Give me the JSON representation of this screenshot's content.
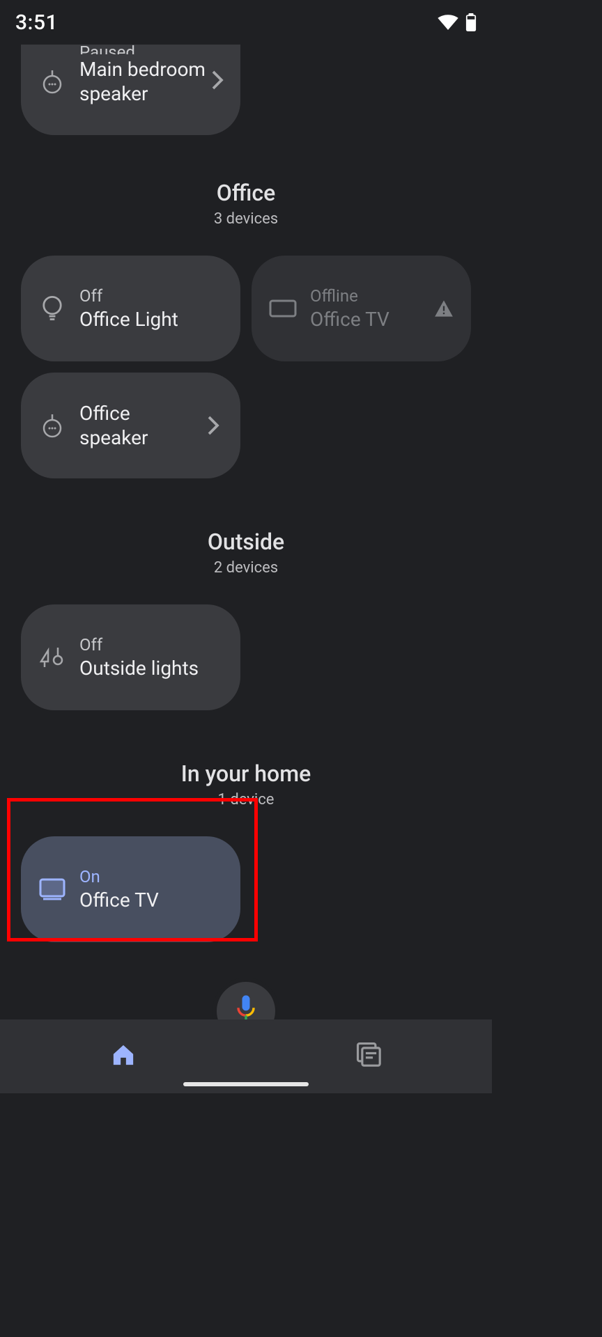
{
  "status_bar": {
    "time": "3:51"
  },
  "partial": {
    "status_cut": "Paused",
    "name": "Main bedroom speaker"
  },
  "rooms": [
    {
      "title": "Office",
      "subtitle": "3 devices",
      "cards": [
        {
          "status": "Off",
          "name": "Office Light"
        },
        {
          "status": "Offline",
          "name": "Office TV"
        },
        {
          "status": "",
          "name": "Office speaker"
        }
      ]
    },
    {
      "title": "Outside",
      "subtitle": "2 devices",
      "cards": [
        {
          "status": "Off",
          "name": "Outside lights"
        }
      ]
    },
    {
      "title": "In your home",
      "subtitle": "1 device",
      "cards": [
        {
          "status": "On",
          "name": "Office TV"
        }
      ]
    }
  ]
}
